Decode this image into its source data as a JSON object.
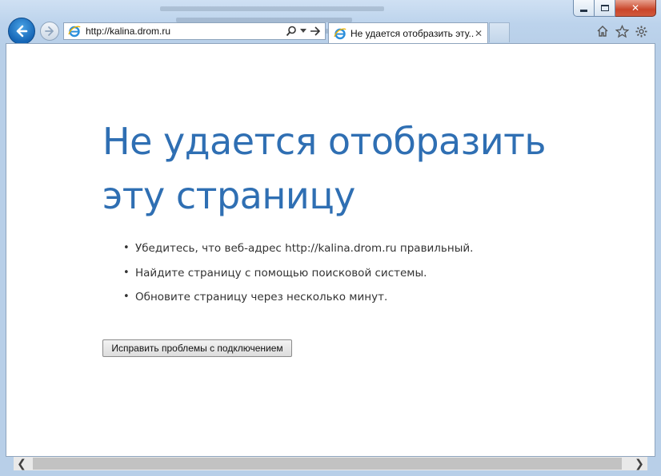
{
  "window": {
    "caption_close": "✕"
  },
  "toolbar": {
    "address_url": "http://kalina.drom.ru",
    "search_icon": "magnifier-icon",
    "go_icon": "arrow-right-icon"
  },
  "tab": {
    "title": "Не удается отобразить эту...",
    "close_label": "✕"
  },
  "page": {
    "title": "Не удается отобразить эту страницу",
    "tips": [
      "Убедитесь, что веб-адрес http://kalina.drom.ru правильный.",
      "Найдите страницу с помощью поисковой системы.",
      "Обновите страницу через несколько минут."
    ],
    "bullet": "•",
    "fix_button": "Исправить проблемы с подключением"
  },
  "scrollbar": {
    "left_arrow": "❮",
    "right_arrow": "❯"
  },
  "colors": {
    "title_blue": "#2f6fb3",
    "back_button_blue": "#1565b5",
    "close_button_red": "#c9452a"
  }
}
